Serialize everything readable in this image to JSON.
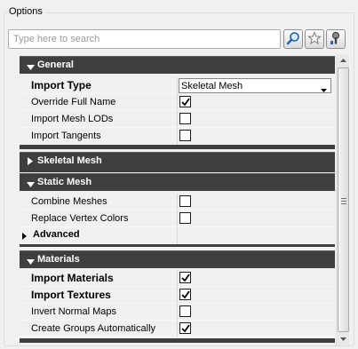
{
  "title": "Options",
  "search": {
    "placeholder": "Type here to search"
  },
  "toolbar": [
    {
      "name": "search-button",
      "icon": "magnifier-icon"
    },
    {
      "name": "favorites-button",
      "icon": "star-icon"
    },
    {
      "name": "settings-button",
      "icon": "wrench-icon"
    }
  ],
  "categories": {
    "general": {
      "label": "General",
      "expanded": true,
      "rows": {
        "import_type": {
          "label": "Import Type",
          "value": "Skeletal Mesh"
        },
        "override_full_name": {
          "label": "Override Full Name",
          "checked": true
        },
        "import_mesh_lods": {
          "label": "Import Mesh LODs",
          "checked": false
        },
        "import_tangents": {
          "label": "Import Tangents",
          "checked": false
        }
      }
    },
    "skeletal_mesh": {
      "label": "Skeletal Mesh",
      "expanded": false
    },
    "static_mesh": {
      "label": "Static Mesh",
      "expanded": true,
      "rows": {
        "combine_meshes": {
          "label": "Combine Meshes",
          "checked": false
        },
        "replace_vertex_colors": {
          "label": "Replace Vertex Colors",
          "checked": false
        },
        "advanced": {
          "label": "Advanced"
        }
      }
    },
    "materials": {
      "label": "Materials",
      "expanded": true,
      "rows": {
        "import_materials": {
          "label": "Import Materials",
          "checked": true
        },
        "import_textures": {
          "label": "Import Textures",
          "checked": true
        },
        "invert_normal_maps": {
          "label": "Invert Normal Maps",
          "checked": false
        },
        "create_groups_automatically": {
          "label": "Create Groups Automatically",
          "checked": true
        }
      }
    }
  },
  "colors": {
    "category_header": "#3f3f3f",
    "panel_bg": "#f0f0f0"
  }
}
